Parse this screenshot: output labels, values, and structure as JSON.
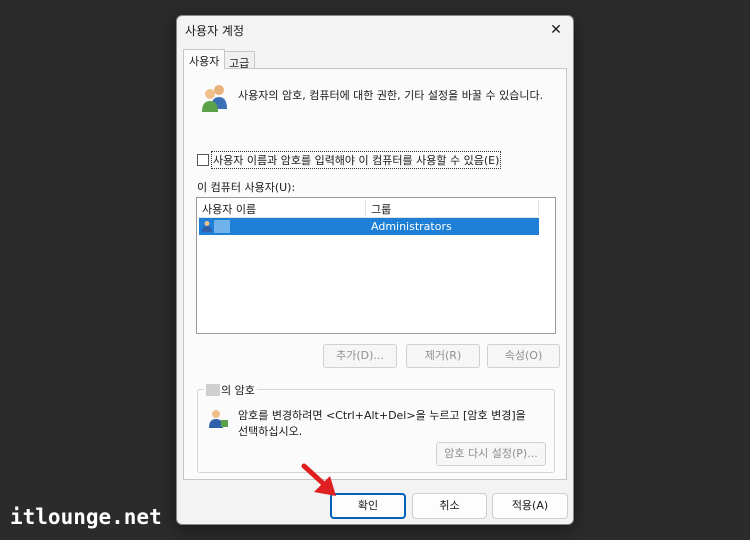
{
  "dialog": {
    "title": "사용자 계정",
    "tabs": [
      {
        "label": "사용자",
        "active": true
      },
      {
        "label": "고급",
        "active": false
      }
    ],
    "description": "사용자의 암호, 컴퓨터에 대한 권한, 기타 설정을 바꿀 수 있습니다.",
    "require_login_checkbox": {
      "label": "사용자 이름과 암호를 입력해야 이 컴퓨터를 사용할 수 있음(E)",
      "checked": false
    },
    "users_list": {
      "label": "이 컴퓨터 사용자(U):",
      "columns": [
        "사용자 이름",
        "그룹"
      ],
      "rows": [
        {
          "name": "",
          "group": "Administrators",
          "selected": true
        }
      ]
    },
    "list_buttons": {
      "add": "추가(D)...",
      "remove": "제거(R)",
      "properties": "속성(O)"
    },
    "password_group": {
      "legend_suffix": "의 암호",
      "text": "암호를 변경하려면 <Ctrl+Alt+Del>을 누르고 [암호 변경]을 선택하십시오.",
      "reset_button": "암호 다시 설정(P)..."
    },
    "footer": {
      "ok": "확인",
      "cancel": "취소",
      "apply": "적용(A)"
    }
  },
  "colors": {
    "accent": "#005fb8",
    "selection": "#1e7fd6",
    "arrow": "#e02020"
  },
  "watermark": "itlounge.net"
}
